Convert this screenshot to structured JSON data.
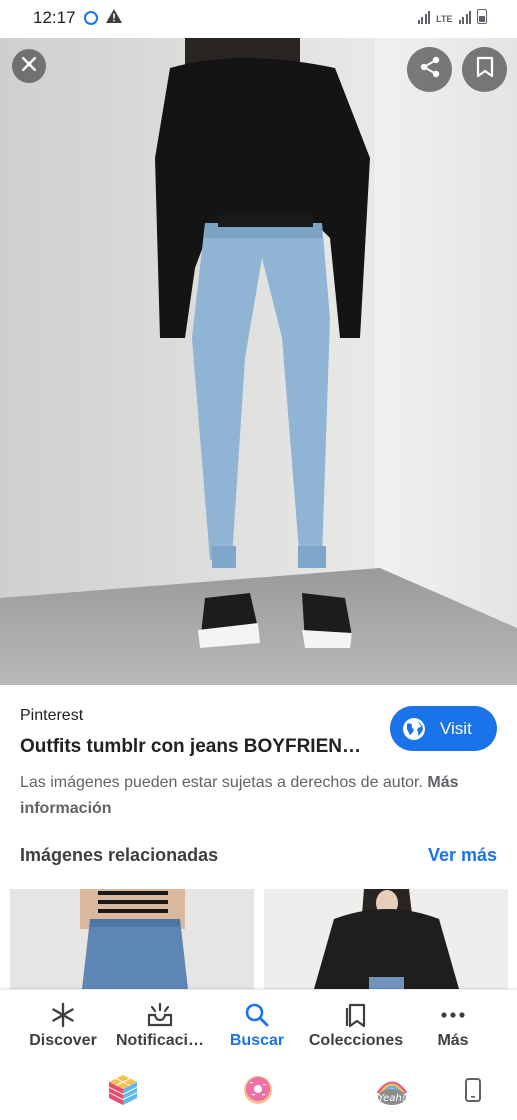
{
  "status_bar": {
    "time": "12:17",
    "network": "LTE"
  },
  "viewer": {
    "close_icon": "close-icon",
    "share_icon": "share-icon",
    "save_icon": "bookmark-icon"
  },
  "result": {
    "source": "Pinterest",
    "title": "Outfits tumblr con jeans BOYFRIEN…",
    "visit_label": "Visit",
    "copyright_text": "Las imágenes pueden estar sujetas a derechos de autor.",
    "more_info": "Más información"
  },
  "related": {
    "heading": "Imágenes relacionadas",
    "see_more": "Ver más"
  },
  "bottom_nav": {
    "items": [
      {
        "label": "Discover",
        "icon": "asterisk-icon"
      },
      {
        "label": "Notificaci…",
        "icon": "notification-tray-icon"
      },
      {
        "label": "Buscar",
        "icon": "search-icon",
        "active": true
      },
      {
        "label": "Colecciones",
        "icon": "collections-icon"
      },
      {
        "label": "Más",
        "icon": "more-dots-icon"
      }
    ],
    "active_color": "#1a73e8"
  },
  "system_tray": [
    "rubik-cube-app-icon",
    "donut-app-icon",
    "yeah-sticker-app-icon",
    "phone-outline-icon"
  ]
}
